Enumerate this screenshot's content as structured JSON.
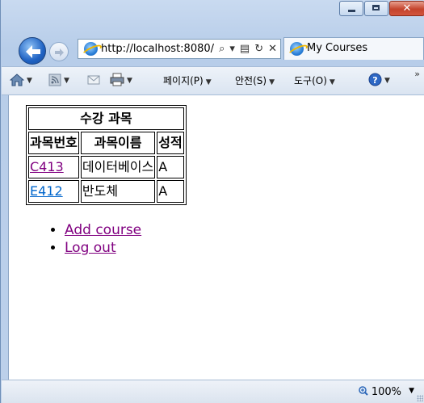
{
  "browser": {
    "address": {
      "url": "http://localhost:8080/",
      "search_glyph": "⌕",
      "dropdown_glyph": "▾",
      "refresh_glyph": "↻",
      "stop_glyph": "✕"
    },
    "tab": {
      "title": "My Courses"
    },
    "command_bar": {
      "page_label": "페이지(P)",
      "safety_label": "안전(S)",
      "tools_label": "도구(O)",
      "dropdown_glyph": "▼",
      "chevron": "»"
    },
    "status": {
      "zoom": "100%",
      "zoom_dropdown": "▼"
    },
    "caption": {
      "close_glyph": "✕"
    }
  },
  "page": {
    "table": {
      "caption": "수강 과목",
      "headers": [
        "과목번호",
        "과목이름",
        "성적"
      ],
      "rows": [
        {
          "code": "C413",
          "name": "데이터베이스",
          "grade": "A"
        },
        {
          "code": "E412",
          "name": "반도체",
          "grade": "A"
        }
      ]
    },
    "links": {
      "add_course": "Add course",
      "log_out": "Log out"
    }
  },
  "colors": {
    "visited_link": "#800080",
    "unvisited_link": "#0066cc",
    "close_button": "#c4432c"
  }
}
